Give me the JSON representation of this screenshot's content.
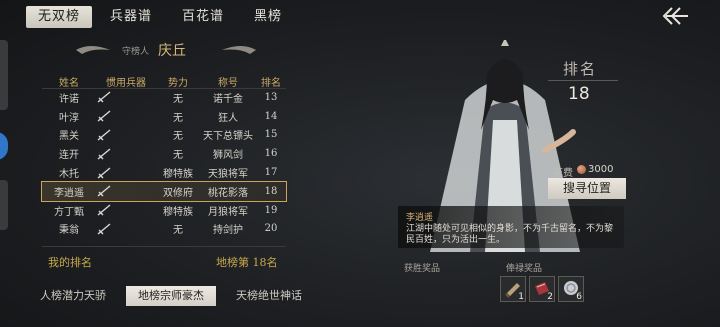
{
  "top_tabs": [
    "无双榜",
    "兵器谱",
    "百花谱",
    "黑榜"
  ],
  "guardian": {
    "label": "守榜人",
    "name": "庆丘"
  },
  "table": {
    "headers": [
      "姓名",
      "惯用兵器",
      "势力",
      "称号",
      "排名"
    ],
    "rows": [
      {
        "name": "许诺",
        "weapon": "sword-icon",
        "faction": "无",
        "title": "诺千金",
        "rank": "13"
      },
      {
        "name": "叶淳",
        "weapon": "sword-icon",
        "faction": "无",
        "title": "狂人",
        "rank": "14"
      },
      {
        "name": "黑关",
        "weapon": "sword-icon",
        "faction": "无",
        "title": "天下总镖头",
        "rank": "15"
      },
      {
        "name": "连开",
        "weapon": "sword-icon",
        "faction": "无",
        "title": "狮风剑",
        "rank": "16"
      },
      {
        "name": "木托",
        "weapon": "sword-icon",
        "faction": "穆特族",
        "title": "天狼将军",
        "rank": "17"
      },
      {
        "name": "李逍遥",
        "weapon": "sword-icon",
        "faction": "双修府",
        "title": "桃花影落",
        "rank": "18",
        "highlighted": true
      },
      {
        "name": "方丁甄",
        "weapon": "sword-icon",
        "faction": "穆特族",
        "title": "月狼将军",
        "rank": "19"
      },
      {
        "name": "秉翁",
        "weapon": "sword-icon",
        "faction": "无",
        "title": "持剑护",
        "rank": "20"
      }
    ]
  },
  "my_rank": {
    "label": "我的排名",
    "value": "地榜第 18名"
  },
  "bottom_tabs": [
    "人榜潜力天骄",
    "地榜宗师豪杰",
    "天榜绝世神话"
  ],
  "character": {
    "rank_label": "排名",
    "rank_value": "18",
    "cost_label": "花费",
    "cost_value": "3000",
    "search_button": "搜寻位置",
    "quote_name": "李逍遥",
    "quote_text": "江湖中随处可见相似的身影，不为千古留名，不为黎民百姓，只为活出一生。"
  },
  "rewards": {
    "win_label": "获胜奖品",
    "loss_label": "俸禄奖品",
    "items": [
      {
        "icon": "scroll-icon",
        "count": "1"
      },
      {
        "icon": "red-book-icon",
        "count": "2"
      },
      {
        "icon": "silver-coin-icon",
        "count": "6"
      }
    ]
  },
  "colors": {
    "gold": "#c8a45c",
    "rank_text": "#c8a84e",
    "accent_blue": "#2f77c9"
  }
}
